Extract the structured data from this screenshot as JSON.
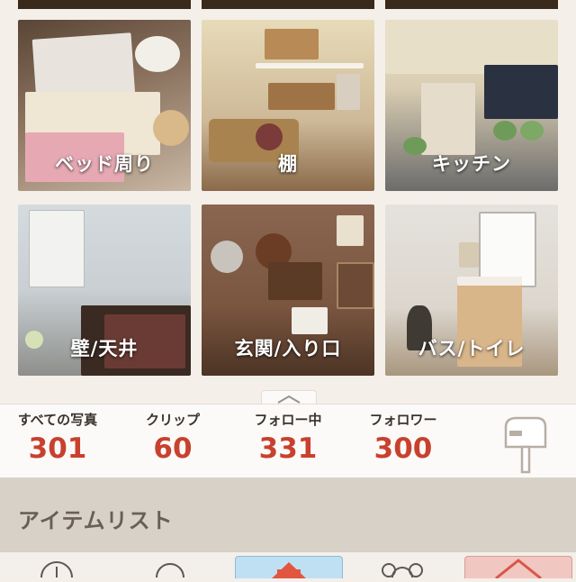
{
  "gallery": {
    "tiles": [
      {
        "label": ""
      },
      {
        "label": ""
      },
      {
        "label": ""
      },
      {
        "label": "ベッド周り"
      },
      {
        "label": "棚"
      },
      {
        "label": "キッチン"
      },
      {
        "label": "壁/天井"
      },
      {
        "label": "玄関/入り口"
      },
      {
        "label": "バス/トイレ"
      }
    ]
  },
  "stats": {
    "photos_label": "すべての写真",
    "photos_value": "301",
    "clips_label": "クリップ",
    "clips_value": "60",
    "following_label": "フォロー中",
    "following_value": "331",
    "followers_label": "フォロワー",
    "followers_value": "300"
  },
  "section": {
    "title": "アイテムリスト"
  },
  "tabbar": {
    "icons": [
      "clock-icon",
      "search-icon",
      "home-icon",
      "people-icon",
      "my-room-icon"
    ]
  },
  "colors": {
    "accent": "#c8412e",
    "background": "#f4efe9"
  }
}
